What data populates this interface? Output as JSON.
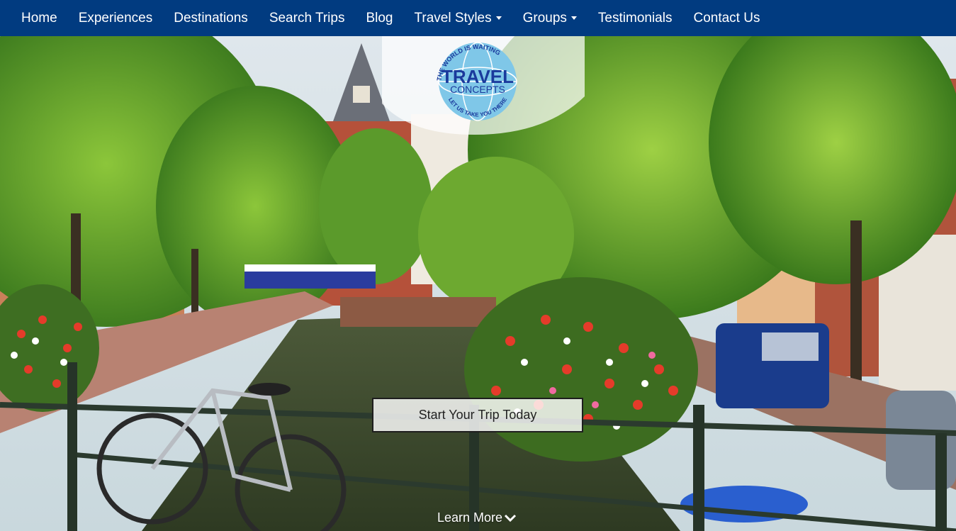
{
  "nav": {
    "items": [
      {
        "label": "Home"
      },
      {
        "label": "Experiences"
      },
      {
        "label": "Destinations"
      },
      {
        "label": "Search Trips"
      },
      {
        "label": "Blog"
      },
      {
        "label": "Travel Styles",
        "dropdown": true
      },
      {
        "label": "Groups",
        "dropdown": true
      },
      {
        "label": "Testimonials"
      },
      {
        "label": "Contact Us"
      }
    ]
  },
  "logo": {
    "top_text": "THE WORLD IS WAITING",
    "line1": "TRAVEL",
    "line2": "CONCEPTS",
    "bottom_text": "LET US TAKE YOU THERE"
  },
  "hero": {
    "cta_label": "Start Your Trip Today",
    "learn_more_label": "Learn More"
  },
  "colors": {
    "nav_bg": "#013b80",
    "logo_blue": "#1a3a9c",
    "globe_light": "#7fc7e8"
  },
  "icons": [
    "chevron-down-icon",
    "caret-down-icon",
    "globe-icon"
  ]
}
